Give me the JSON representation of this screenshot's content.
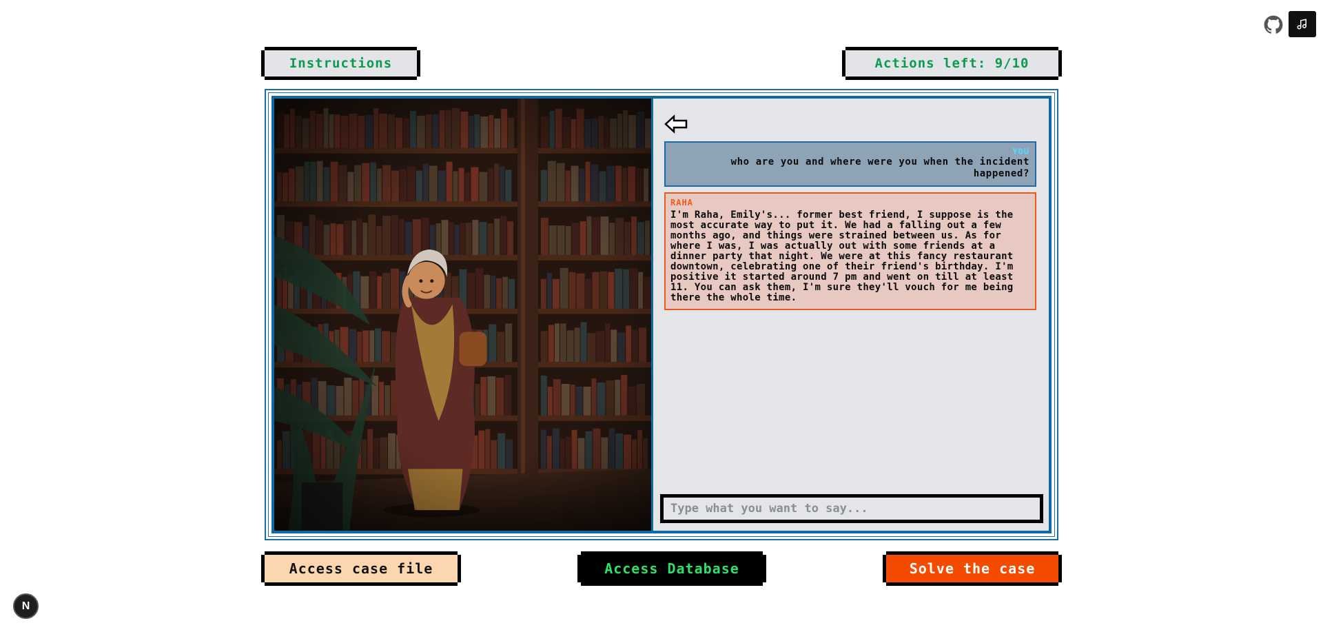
{
  "header": {
    "instructions_label": "Instructions",
    "actions_label": "Actions left: 9/10",
    "github_icon": "github-icon",
    "music_icon": "music-note-icon"
  },
  "scene": {
    "description_icon": "character-portrait"
  },
  "chat": {
    "back_icon": "back-arrow-icon",
    "messages": [
      {
        "sender": "YOU",
        "text": "who are you and where were you when the incident happened?"
      },
      {
        "sender": "RAHA",
        "text": "I'm Raha, Emily's... former best friend, I suppose is the most accurate way to put it. We had a falling out a few months ago, and things were strained between us. As for where I was, I was actually out with some friends at a dinner party that night. We were at this fancy restaurant downtown, celebrating one of their friend's birthday. I'm positive it started around 7 pm and went on till at least 11. You can ask them, I'm sure they'll vouch for me being there the whole time."
      }
    ],
    "input_placeholder": "Type what you want to say...",
    "input_value": ""
  },
  "footer": {
    "case_file_label": "Access case file",
    "database_label": "Access Database",
    "solve_label": "Solve the case",
    "badge_letter": "N"
  },
  "colors": {
    "accent_green": "#0b9a4e",
    "frame_blue": "#0f6aa3",
    "npc_orange": "#f0581c",
    "solve_orange": "#f54b00",
    "you_bg": "#8fa3b7",
    "npc_bg": "#e8c9c2"
  }
}
